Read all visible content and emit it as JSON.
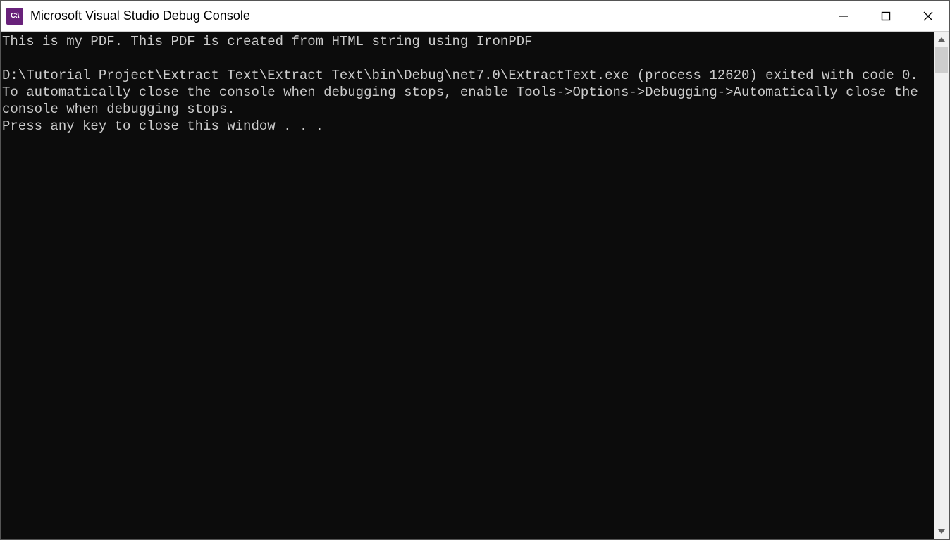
{
  "window": {
    "title": "Microsoft Visual Studio Debug Console",
    "icon_label": "C:\\"
  },
  "console": {
    "lines": [
      "This is my PDF. This PDF is created from HTML string using IronPDF",
      "",
      "D:\\Tutorial Project\\Extract Text\\Extract Text\\bin\\Debug\\net7.0\\ExtractText.exe (process 12620) exited with code 0.",
      "To automatically close the console when debugging stops, enable Tools->Options->Debugging->Automatically close the console when debugging stops.",
      "Press any key to close this window . . ."
    ]
  }
}
